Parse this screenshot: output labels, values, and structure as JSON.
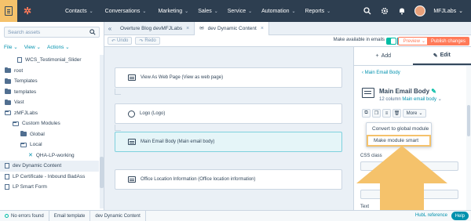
{
  "topnav": {
    "items": [
      {
        "label": "Contacts"
      },
      {
        "label": "Conversations"
      },
      {
        "label": "Marketing"
      },
      {
        "label": "Sales"
      },
      {
        "label": "Service"
      },
      {
        "label": "Automation"
      },
      {
        "label": "Reports"
      }
    ],
    "account_name": "MFJLabs"
  },
  "sidebar": {
    "search_placeholder": "Search assets",
    "menu": [
      "File",
      "View",
      "Actions"
    ],
    "tree": [
      {
        "label": "WCS_Testimonial_Slider",
        "type": "file",
        "indent": 3
      },
      {
        "label": "root",
        "type": "folder",
        "indent": 1
      },
      {
        "label": "Templates",
        "type": "folder",
        "indent": 1
      },
      {
        "label": "templates",
        "type": "folder",
        "indent": 1
      },
      {
        "label": "Vast",
        "type": "folder",
        "indent": 1
      },
      {
        "label": "zMFJLabs",
        "type": "folder-open",
        "indent": 1
      },
      {
        "label": "Custom Modules",
        "type": "folder-open",
        "indent": 2
      },
      {
        "label": "Global",
        "type": "folder",
        "indent": 3
      },
      {
        "label": "Local",
        "type": "folder-open",
        "indent": 3
      },
      {
        "label": "QHA-LP-working",
        "type": "x",
        "indent": 4
      },
      {
        "label": "dev Dynamic Content",
        "type": "file",
        "indent": 1,
        "active": true
      },
      {
        "label": "LP Certificate - Inbound BadAss",
        "type": "file",
        "indent": 1
      },
      {
        "label": "LP Smart Form",
        "type": "file",
        "indent": 1
      }
    ]
  },
  "tabs": [
    {
      "label": "Overture Blog devMFJLabs"
    },
    {
      "label": "dev Dynamic Content"
    }
  ],
  "toolbar": {
    "undo": "Undo",
    "redo": "Redo",
    "available_label": "Make available in emails",
    "preview": "Preview",
    "publish": "Publish changes"
  },
  "modules": [
    {
      "label": "View As Web Page (View as web page)"
    },
    {
      "label": "Logo (Logo)"
    },
    {
      "label": "Main Email Body (Main email body)"
    },
    {
      "label": "Office Location Information (Office location information)"
    }
  ],
  "panel": {
    "tab_add": "Add",
    "tab_edit": "Edit",
    "breadcrumb": "Main Email Body",
    "title": "Main Email Body",
    "sub_prefix": "12 column",
    "sub_link": "Main email body",
    "more": "More",
    "dropdown": [
      "Convert to global module",
      "Make module smart"
    ],
    "css_class_label": "CSS class",
    "text_label": "Text"
  },
  "statusbar": {
    "errors": "No errors found",
    "type": "Email template",
    "name": "dev Dynamic Content",
    "hubl": "HubL reference",
    "help": "Help"
  },
  "colors": {
    "nav_bg": "#2d3e50",
    "accent_orange": "#ff7a59",
    "link_teal": "#0091ae",
    "highlight_yellow": "#f5c26b",
    "selected_module": "#e5f5f8"
  }
}
